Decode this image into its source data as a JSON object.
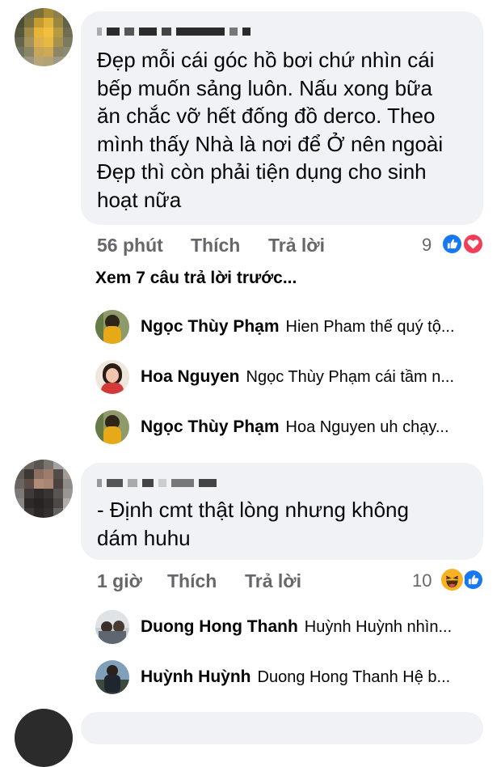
{
  "comments": [
    {
      "text": "Đẹp mỗi cái góc hồ bơi chứ nhìn cái\nbếp muốn sảng luôn. Nấu xong bữa\năn chắc vỡ hết đống đồ derco. Theo\nmình thấy Nhà là nơi để Ở nên ngoài\nĐẹp thì còn phải tiện dụng cho sinh\nhoạt nữa",
      "time": "56 phút",
      "like_label": "Thích",
      "reply_label": "Trả lời",
      "reaction_count": "9",
      "reactions": [
        "like-icon",
        "love-icon"
      ]
    },
    {
      "text": "- Định cmt thật lòng nhưng không\ndám huhu",
      "time": "1 giờ",
      "like_label": "Thích",
      "reply_label": "Trả lời",
      "reaction_count": "10",
      "reactions": [
        "haha-icon",
        "like-icon"
      ]
    }
  ],
  "view_more_label": "Xem 7 câu trả lời trước...",
  "replies_group_1": [
    {
      "name": "Ngọc Thùy Phạm",
      "snippet": "Hien Pham thế quý tộ..."
    },
    {
      "name": "Hoa Nguyen",
      "snippet": "Ngọc Thùy Phạm cái tầm n..."
    },
    {
      "name": "Ngọc Thùy Phạm",
      "snippet": "Hoa Nguyen uh chạy..."
    }
  ],
  "replies_group_2": [
    {
      "name": "Duong Hong Thanh",
      "snippet": "Huỳnh Huỳnh nhìn..."
    },
    {
      "name": "Huỳnh Huỳnh",
      "snippet": "Duong Hong Thanh Hệ b..."
    }
  ],
  "colors": {
    "bubble": "#f0f2f5",
    "meta_text": "#65676b",
    "like_blue": "#1877f2",
    "love_red": "#f33e58",
    "haha_yellow": "#f7b125"
  }
}
